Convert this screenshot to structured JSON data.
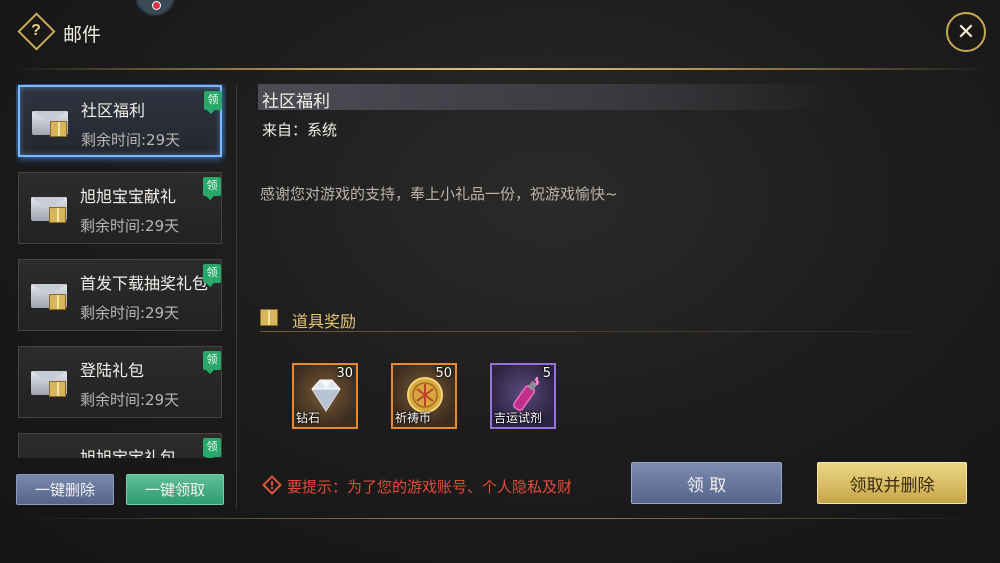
{
  "header": {
    "title": "邮件",
    "help_symbol": "?",
    "close_symbol": "✕"
  },
  "mail_list": {
    "items": [
      {
        "title": "社区福利",
        "time": "剩余时间:29天",
        "badge": "领",
        "selected": true
      },
      {
        "title": "旭旭宝宝献礼",
        "time": "剩余时间:29天",
        "badge": "领",
        "selected": false
      },
      {
        "title": "首发下载抽奖礼包",
        "time": "剩余时间:29天",
        "badge": "领",
        "selected": false
      },
      {
        "title": "登陆礼包",
        "time": "剩余时间:29天",
        "badge": "领",
        "selected": false
      },
      {
        "title": "旭旭宝宝礼包",
        "time": "",
        "badge": "领",
        "selected": false
      }
    ],
    "delete_all_label": "一键删除",
    "claim_all_label": "一键领取"
  },
  "detail": {
    "title": "社区福利",
    "from": "来自：系统",
    "body": "感谢您对游戏的支持，奉上小礼品一份，祝游戏愉快~",
    "rewards_label": "道具奖励",
    "rewards": [
      {
        "name": "钻石",
        "count": "30",
        "icon": "diamond-icon",
        "rarity": "orange"
      },
      {
        "name": "祈祷币",
        "count": "50",
        "icon": "coin-icon",
        "rarity": "orange"
      },
      {
        "name": "吉运试剂",
        "count": "5",
        "icon": "potion-icon",
        "rarity": "purple"
      }
    ],
    "tip_text": "要提示：为了您的游戏账号、个人隐私及财",
    "tip_symbol": "!",
    "claim_label": "领 取",
    "claim_delete_label": "领取并删除"
  },
  "colors": {
    "gold": "#c9a857",
    "selection_glow": "#79b9ff",
    "badge_green": "#2aa86a",
    "warning_red": "#e24a3a"
  }
}
